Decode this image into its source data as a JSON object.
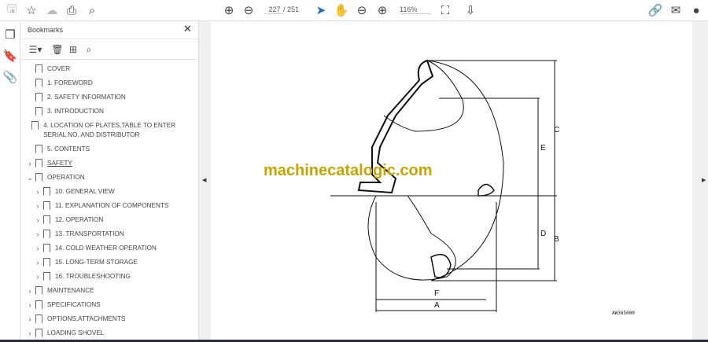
{
  "toolbar": {
    "page_current": "227",
    "page_total": "/ 251",
    "zoom": "116%"
  },
  "bookmarks": {
    "title": "Bookmarks",
    "items": [
      {
        "label": "COVER",
        "chev": "",
        "indent": 0
      },
      {
        "label": "1. FOREWORD",
        "chev": "",
        "indent": 0
      },
      {
        "label": "2. SAFETY INFORMATION",
        "chev": "",
        "indent": 0
      },
      {
        "label": "3. INTRODUCTION",
        "chev": "",
        "indent": 0
      },
      {
        "label": "4. LOCATION OF PLATES,TABLE TO ENTER SERIAL NO. AND DISTRIBUTOR",
        "chev": "",
        "indent": 0
      },
      {
        "label": "5. CONTENTS",
        "chev": "",
        "indent": 0
      },
      {
        "label": "SAFETY",
        "chev": "›",
        "indent": 0
      },
      {
        "label": "OPERATION",
        "chev": "⌄",
        "indent": 0
      },
      {
        "label": "10. GENERAL VIEW",
        "chev": "›",
        "indent": 1
      },
      {
        "label": "11. EXPLANATION OF COMPONENTS",
        "chev": "›",
        "indent": 1
      },
      {
        "label": "12. OPERATION",
        "chev": "›",
        "indent": 1
      },
      {
        "label": "13. TRANSPORTATION",
        "chev": "›",
        "indent": 1
      },
      {
        "label": "14. COLD WEATHER OPERATION",
        "chev": "›",
        "indent": 1
      },
      {
        "label": "15. LONG-TERM STORAGE",
        "chev": "›",
        "indent": 1
      },
      {
        "label": "16. TROUBLESHOOTING",
        "chev": "›",
        "indent": 1
      },
      {
        "label": "MAINTENANCE",
        "chev": "›",
        "indent": 0
      },
      {
        "label": "SPECIFICATIONS",
        "chev": "›",
        "indent": 0
      },
      {
        "label": "OPTIONS,ATTACHMENTS",
        "chev": "›",
        "indent": 0
      },
      {
        "label": "LOADING SHOVEL",
        "chev": "›",
        "indent": 0
      }
    ]
  },
  "document": {
    "watermark": "machinecatalogic.com",
    "labels": {
      "C": "C",
      "E": "E",
      "D": "D",
      "B": "B",
      "F": "F",
      "A": "A"
    },
    "figure_id": "AW365000"
  }
}
